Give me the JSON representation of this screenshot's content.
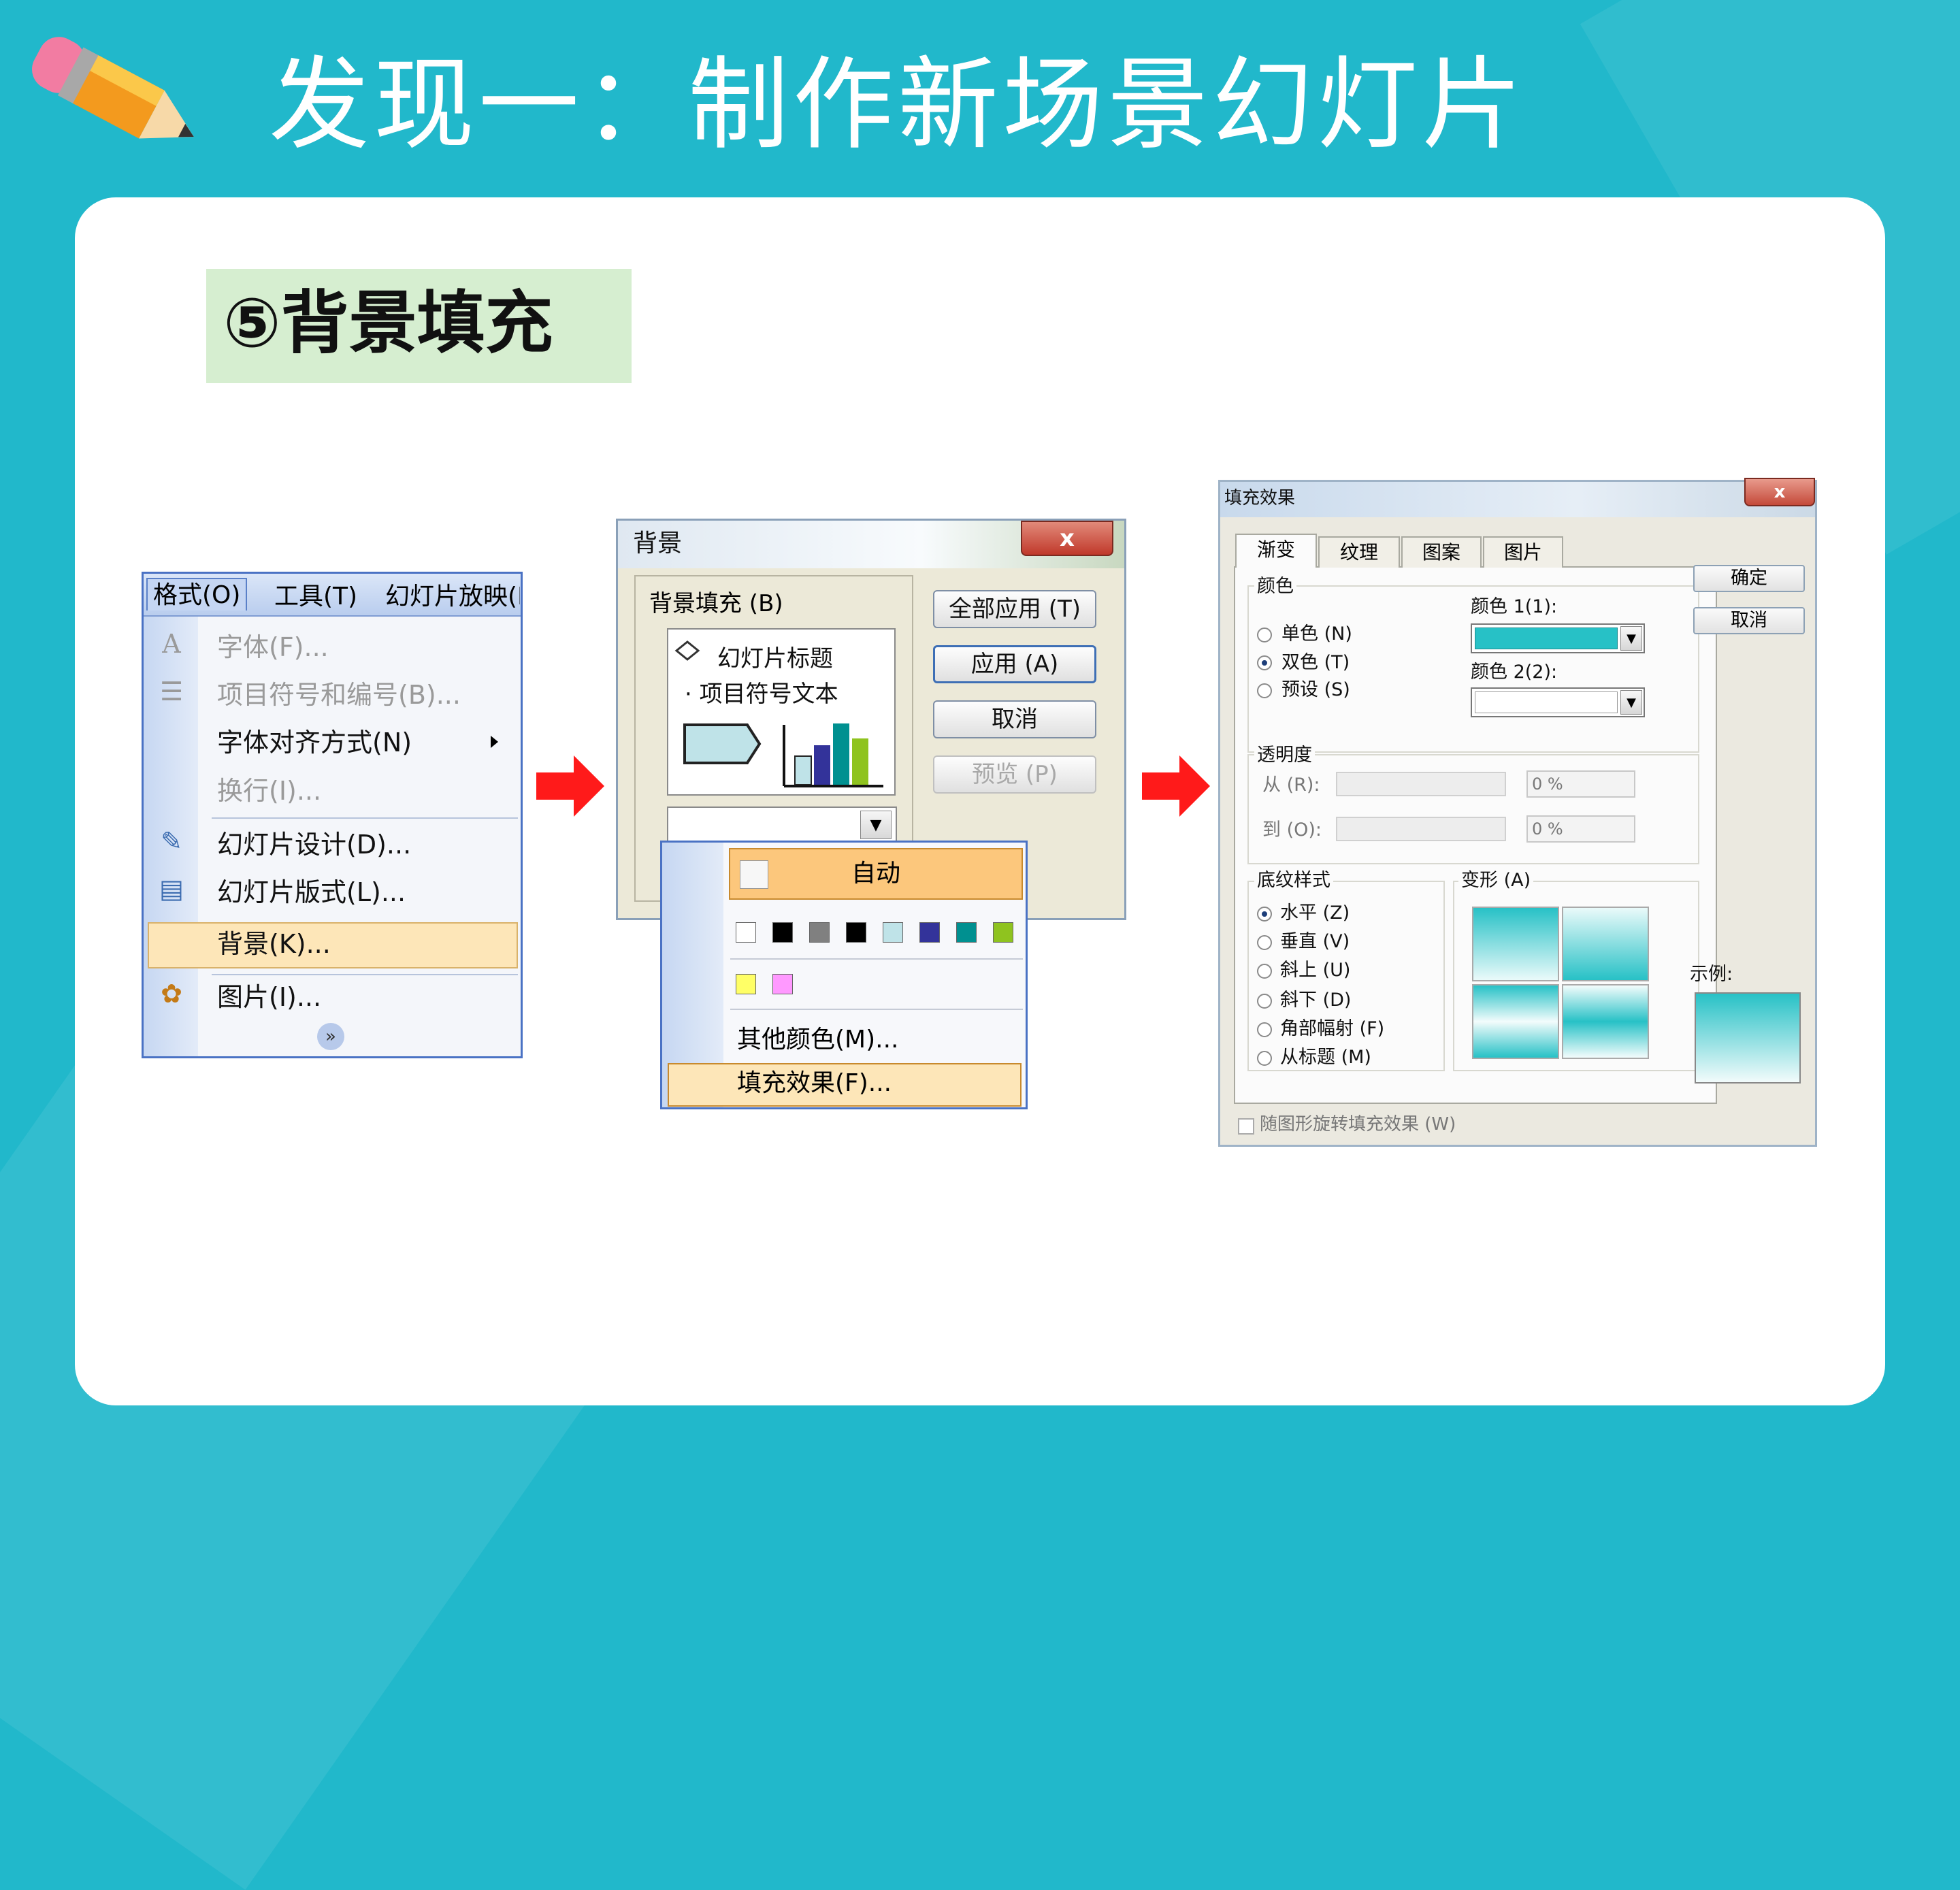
{
  "slide": {
    "title": "发现一：制作新场景幻灯片",
    "subtitle": "⑤背景填充"
  },
  "colors": {
    "bg": "#21b8cb",
    "subtitle_bg": "#d6eed0",
    "arrow": "#ff1a1a",
    "gradient": "#27c1c6"
  },
  "format_menu": {
    "menubar": [
      "格式(O)",
      "工具(T)",
      "幻灯片放映(D"
    ],
    "items": [
      "字体(F)...",
      "项目符号和编号(B)...",
      "字体对齐方式(N)",
      "换行(I)...",
      "幻灯片设计(D)...",
      "幻灯片版式(L)...",
      "背景(K)...",
      "图片(I)..."
    ],
    "icons": {
      "font": "A",
      "bullets": "☰",
      "design": "✎",
      "layout": "▤",
      "picture": "✿",
      "more": "»"
    }
  },
  "background_dialog": {
    "title": "背景",
    "close": "x",
    "group_label": "背景填充 (B)",
    "preview_title": "幻灯片标题",
    "preview_bullet": "· 项目符号文本",
    "buttons": {
      "apply_all": "全部应用 (T)",
      "apply": "应用 (A)",
      "cancel": "取消",
      "preview": "预览 (P)"
    }
  },
  "color_dropdown": {
    "auto": "自动",
    "swatches_row1": [
      "#ffffff",
      "#000000",
      "#808080",
      "#000000",
      "#bfe3e8",
      "#33339a",
      "#009090",
      "#8fc31f"
    ],
    "swatches_row2": [
      "#ffff66",
      "#ff99ff"
    ],
    "more_colors": "其他颜色(M)...",
    "fill_effects": "填充效果(F)..."
  },
  "fill_effects_dialog": {
    "title": "填充效果",
    "close": "x",
    "tabs": [
      "渐变",
      "纹理",
      "图案",
      "图片"
    ],
    "colors_group": "颜色",
    "color_options": [
      "单色 (N)",
      "双色 (T)",
      "预设 (S)"
    ],
    "color1_label": "颜色 1(1):",
    "color2_label": "颜色 2(2):",
    "color1_value": "#27c1c6",
    "color2_value": "#ffffff",
    "transparency_group": "透明度",
    "from_label": "从 (R):",
    "to_label": "到 (O):",
    "from_value": "0 %",
    "to_value": "0 %",
    "shading_group": "底纹样式",
    "shading_options": [
      "水平 (Z)",
      "垂直 (V)",
      "斜上 (U)",
      "斜下 (D)",
      "角部幅射 (F)",
      "从标题 (M)"
    ],
    "variants_label": "变形 (A)",
    "ok": "确定",
    "cancel": "取消",
    "sample_label": "示例:",
    "rotate_checkbox": "随图形旋转填充效果 (W)"
  }
}
